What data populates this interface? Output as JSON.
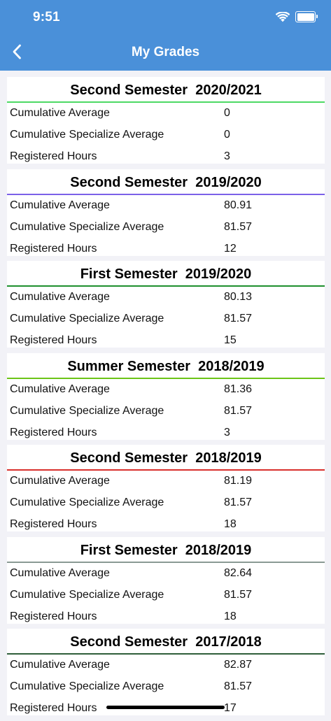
{
  "status_bar": {
    "time": "9:51"
  },
  "nav": {
    "title": "My Grades",
    "back_icon": "chevron-left-icon"
  },
  "colors": {
    "header": "#4a90d9",
    "background": "#f2f2f7"
  },
  "semesters": [
    {
      "title": "Second Semester  2020/2021",
      "accent": "#4cd964",
      "rows": [
        {
          "label": "Cumulative Average",
          "value": "0"
        },
        {
          "label": "Cumulative Specialize Average",
          "value": "0"
        },
        {
          "label": "Registered Hours",
          "value": "3"
        }
      ]
    },
    {
      "title": "Second Semester  2019/2020",
      "accent": "#7b61e8",
      "rows": [
        {
          "label": "Cumulative Average",
          "value": "80.91"
        },
        {
          "label": "Cumulative Specialize Average",
          "value": "81.57"
        },
        {
          "label": "Registered Hours",
          "value": "12"
        }
      ]
    },
    {
      "title": "First Semester  2019/2020",
      "accent": "#1e8f2e",
      "rows": [
        {
          "label": "Cumulative Average",
          "value": "80.13"
        },
        {
          "label": "Cumulative Specialize Average",
          "value": "81.57"
        },
        {
          "label": "Registered Hours",
          "value": "15"
        }
      ]
    },
    {
      "title": "Summer Semester  2018/2019",
      "accent": "#6cc417",
      "rows": [
        {
          "label": "Cumulative Average",
          "value": "81.36"
        },
        {
          "label": "Cumulative Specialize Average",
          "value": "81.57"
        },
        {
          "label": "Registered Hours",
          "value": "3"
        }
      ]
    },
    {
      "title": "Second Semester  2018/2019",
      "accent": "#d9302c",
      "rows": [
        {
          "label": "Cumulative Average",
          "value": "81.19"
        },
        {
          "label": "Cumulative Specialize Average",
          "value": "81.57"
        },
        {
          "label": "Registered Hours",
          "value": "18"
        }
      ]
    },
    {
      "title": "First Semester  2018/2019",
      "accent": "#8a9a94",
      "rows": [
        {
          "label": "Cumulative Average",
          "value": "82.64"
        },
        {
          "label": "Cumulative Specialize Average",
          "value": "81.57"
        },
        {
          "label": "Registered Hours",
          "value": "18"
        }
      ]
    },
    {
      "title": "Second Semester  2017/2018",
      "accent": "#2f5e3a",
      "rows": [
        {
          "label": "Cumulative Average",
          "value": "82.87"
        },
        {
          "label": "Cumulative Specialize Average",
          "value": "81.57"
        },
        {
          "label": "Registered Hours",
          "value": "17"
        }
      ]
    }
  ]
}
